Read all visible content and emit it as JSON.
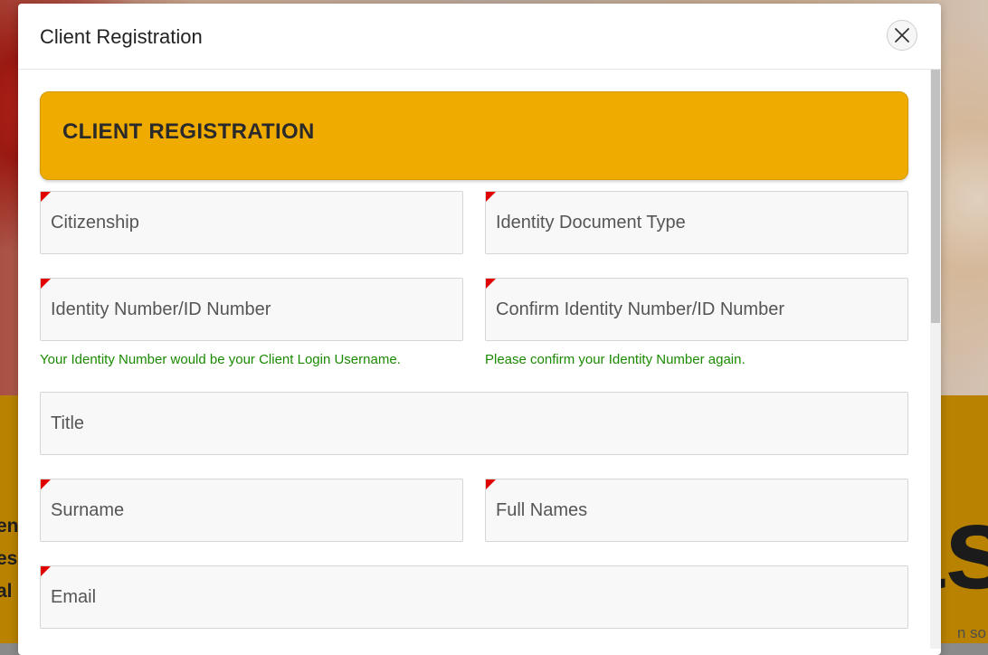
{
  "modal": {
    "title": "Client Registration",
    "banner": "CLIENT REGISTRATION"
  },
  "fields": {
    "citizenship": {
      "placeholder": "Citizenship"
    },
    "id_doc_type": {
      "placeholder": "Identity Document Type"
    },
    "id_number": {
      "placeholder": "Identity Number/ID Number",
      "hint": "Your Identity Number would be your Client Login Username."
    },
    "confirm_id_number": {
      "placeholder": "Confirm Identity Number/ID Number",
      "hint": "Please confirm your Identity Number again."
    },
    "title": {
      "placeholder": "Title"
    },
    "surname": {
      "placeholder": "Surname"
    },
    "full_names": {
      "placeholder": "Full Names"
    },
    "email": {
      "placeholder": "Email"
    }
  },
  "background": {
    "left_lines": [
      "en",
      "es",
      "al"
    ],
    "right_large": "as",
    "right_small": "n so"
  },
  "icons": {
    "close": "close-icon"
  }
}
